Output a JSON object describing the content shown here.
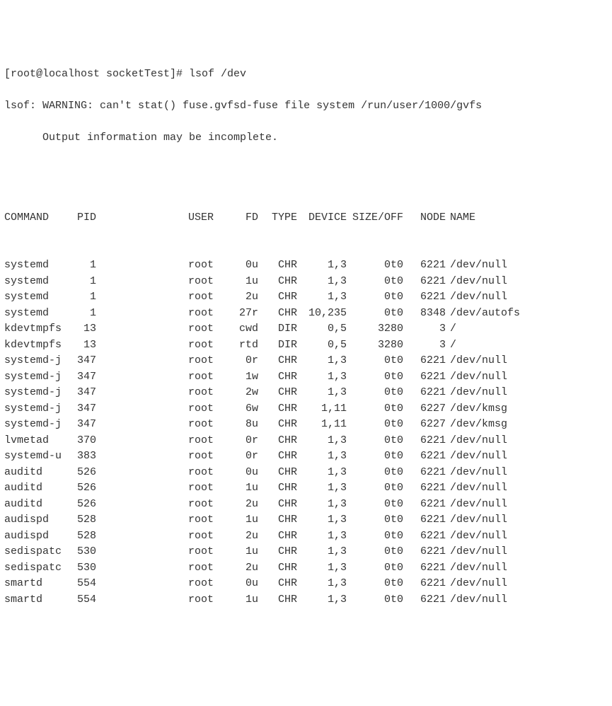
{
  "prompt": "[root@localhost socketTest]# lsof /dev",
  "warning_line1": "lsof: WARNING: can't stat() fuse.gvfsd-fuse file system /run/user/1000/gvfs",
  "warning_line2": "      Output information may be incomplete.",
  "headers": {
    "command": "COMMAND",
    "pid": "PID",
    "user": "USER",
    "fd": "FD",
    "type": "TYPE",
    "device": "DEVICE",
    "sizeoff": "SIZE/OFF",
    "node": "NODE",
    "name": "NAME"
  },
  "rows": [
    {
      "command": "systemd",
      "pid": "1",
      "user": "root",
      "fd": "0u",
      "type": "CHR",
      "device": "1,3",
      "sizeoff": "0t0",
      "node": "6221",
      "name": "/dev/null"
    },
    {
      "command": "systemd",
      "pid": "1",
      "user": "root",
      "fd": "1u",
      "type": "CHR",
      "device": "1,3",
      "sizeoff": "0t0",
      "node": "6221",
      "name": "/dev/null"
    },
    {
      "command": "systemd",
      "pid": "1",
      "user": "root",
      "fd": "2u",
      "type": "CHR",
      "device": "1,3",
      "sizeoff": "0t0",
      "node": "6221",
      "name": "/dev/null"
    },
    {
      "command": "systemd",
      "pid": "1",
      "user": "root",
      "fd": "27r",
      "type": "CHR",
      "device": "10,235",
      "sizeoff": "0t0",
      "node": "8348",
      "name": "/dev/autofs"
    },
    {
      "command": "kdevtmpfs",
      "pid": "13",
      "user": "root",
      "fd": "cwd",
      "type": "DIR",
      "device": "0,5",
      "sizeoff": "3280",
      "node": "3",
      "name": "/"
    },
    {
      "command": "kdevtmpfs",
      "pid": "13",
      "user": "root",
      "fd": "rtd",
      "type": "DIR",
      "device": "0,5",
      "sizeoff": "3280",
      "node": "3",
      "name": "/"
    },
    {
      "command": "systemd-j",
      "pid": "347",
      "user": "root",
      "fd": "0r",
      "type": "CHR",
      "device": "1,3",
      "sizeoff": "0t0",
      "node": "6221",
      "name": "/dev/null"
    },
    {
      "command": "systemd-j",
      "pid": "347",
      "user": "root",
      "fd": "1w",
      "type": "CHR",
      "device": "1,3",
      "sizeoff": "0t0",
      "node": "6221",
      "name": "/dev/null"
    },
    {
      "command": "systemd-j",
      "pid": "347",
      "user": "root",
      "fd": "2w",
      "type": "CHR",
      "device": "1,3",
      "sizeoff": "0t0",
      "node": "6221",
      "name": "/dev/null"
    },
    {
      "command": "systemd-j",
      "pid": "347",
      "user": "root",
      "fd": "6w",
      "type": "CHR",
      "device": "1,11",
      "sizeoff": "0t0",
      "node": "6227",
      "name": "/dev/kmsg"
    },
    {
      "command": "systemd-j",
      "pid": "347",
      "user": "root",
      "fd": "8u",
      "type": "CHR",
      "device": "1,11",
      "sizeoff": "0t0",
      "node": "6227",
      "name": "/dev/kmsg"
    },
    {
      "command": "lvmetad",
      "pid": "370",
      "user": "root",
      "fd": "0r",
      "type": "CHR",
      "device": "1,3",
      "sizeoff": "0t0",
      "node": "6221",
      "name": "/dev/null"
    },
    {
      "command": "systemd-u",
      "pid": "383",
      "user": "root",
      "fd": "0r",
      "type": "CHR",
      "device": "1,3",
      "sizeoff": "0t0",
      "node": "6221",
      "name": "/dev/null"
    },
    {
      "command": "auditd",
      "pid": "526",
      "user": "root",
      "fd": "0u",
      "type": "CHR",
      "device": "1,3",
      "sizeoff": "0t0",
      "node": "6221",
      "name": "/dev/null"
    },
    {
      "command": "auditd",
      "pid": "526",
      "user": "root",
      "fd": "1u",
      "type": "CHR",
      "device": "1,3",
      "sizeoff": "0t0",
      "node": "6221",
      "name": "/dev/null"
    },
    {
      "command": "auditd",
      "pid": "526",
      "user": "root",
      "fd": "2u",
      "type": "CHR",
      "device": "1,3",
      "sizeoff": "0t0",
      "node": "6221",
      "name": "/dev/null"
    },
    {
      "command": "audispd",
      "pid": "528",
      "user": "root",
      "fd": "1u",
      "type": "CHR",
      "device": "1,3",
      "sizeoff": "0t0",
      "node": "6221",
      "name": "/dev/null"
    },
    {
      "command": "audispd",
      "pid": "528",
      "user": "root",
      "fd": "2u",
      "type": "CHR",
      "device": "1,3",
      "sizeoff": "0t0",
      "node": "6221",
      "name": "/dev/null"
    },
    {
      "command": "sedispatc",
      "pid": "530",
      "user": "root",
      "fd": "1u",
      "type": "CHR",
      "device": "1,3",
      "sizeoff": "0t0",
      "node": "6221",
      "name": "/dev/null"
    },
    {
      "command": "sedispatc",
      "pid": "530",
      "user": "root",
      "fd": "2u",
      "type": "CHR",
      "device": "1,3",
      "sizeoff": "0t0",
      "node": "6221",
      "name": "/dev/null"
    },
    {
      "command": "smartd",
      "pid": "554",
      "user": "root",
      "fd": "0u",
      "type": "CHR",
      "device": "1,3",
      "sizeoff": "0t0",
      "node": "6221",
      "name": "/dev/null"
    },
    {
      "command": "smartd",
      "pid": "554",
      "user": "root",
      "fd": "1u",
      "type": "CHR",
      "device": "1,3",
      "sizeoff": "0t0",
      "node": "6221",
      "name": "/dev/null"
    }
  ]
}
